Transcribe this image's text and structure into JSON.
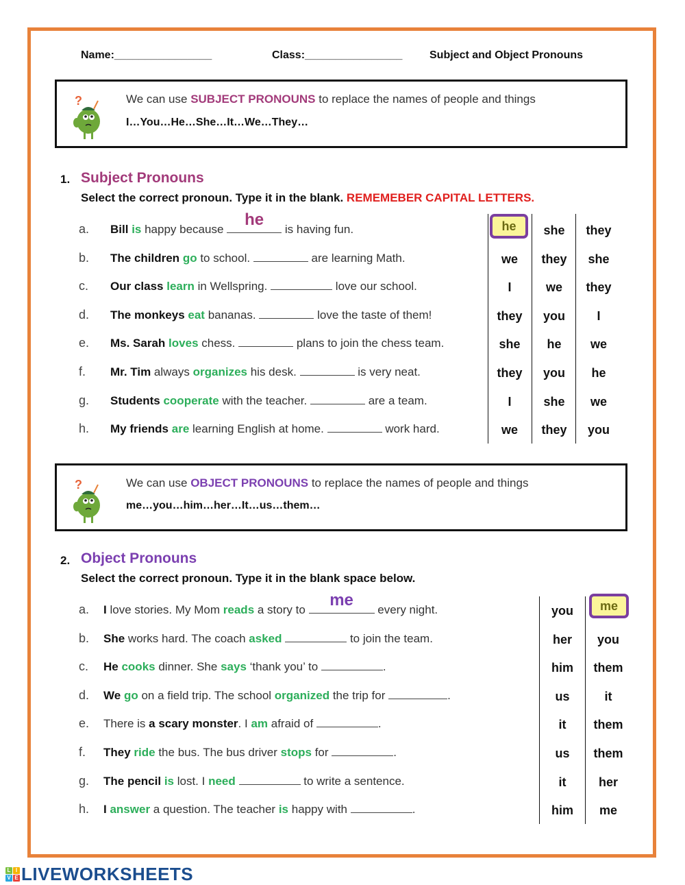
{
  "header": {
    "name_label": "Name:________________",
    "class_label": "Class:________________",
    "title": "Subject and Object Pronouns"
  },
  "colors": {
    "frame": "#e8823a",
    "subject_accent": "#a23a7a",
    "object_accent": "#7b3fb0",
    "verb_green": "#2cae5a",
    "warning_red": "#e0201e",
    "selected_fill": "#fbf59a",
    "selected_border": "#7b3fa0",
    "logo_blue": "#1b4d8e"
  },
  "info_subject": {
    "pre": "We can use ",
    "keyword": "SUBJECT PRONOUNS",
    "post": " to replace the names of people and things",
    "list": "I…You…He…She…It…We…They…",
    "icon": "confused-mascot-icon"
  },
  "info_object": {
    "pre": "We can use ",
    "keyword": "OBJECT PRONOUNS",
    "post": " to replace the names of people and things",
    "list": "me…you…him…her…It…us…them…",
    "icon": "confused-mascot-icon"
  },
  "section1": {
    "number": "1.",
    "title": "Subject Pronouns",
    "instruction": "Select the correct pronoun. Type it in the blank. ",
    "warning": "REMEMEBER CAPITAL LETTERS.",
    "questions": [
      {
        "letter": "a.",
        "subject": "Bill",
        "verb": "is",
        "mid": " happy because ",
        "after": " is having fun.",
        "answer": "he",
        "choices": [
          "he",
          "she",
          "they"
        ],
        "selected": 0
      },
      {
        "letter": "b.",
        "subject": "The children",
        "verb": "go",
        "mid": " to school. ",
        "after": " are learning Math.",
        "answer": "",
        "choices": [
          "we",
          "they",
          "she"
        ],
        "selected": -1
      },
      {
        "letter": "c.",
        "subject": "Our class",
        "verb": "learn",
        "mid": " in Wellspring. ",
        "after": " love our school.",
        "answer": "",
        "choices": [
          "I",
          "we",
          "they"
        ],
        "selected": -1
      },
      {
        "letter": "d.",
        "subject": "The monkeys",
        "verb": "eat",
        "mid": " bananas. ",
        "after": " love the taste of them!",
        "answer": "",
        "choices": [
          "they",
          "you",
          "I"
        ],
        "selected": -1
      },
      {
        "letter": "e.",
        "subject": "Ms. Sarah",
        "verb": "loves",
        "mid": " chess. ",
        "after": " plans to join the chess team.",
        "answer": "",
        "choices": [
          "she",
          "he",
          "we"
        ],
        "selected": -1
      },
      {
        "letter": "f.",
        "subject": "Mr. Tim",
        "pre_verb": " always ",
        "verb": "organizes",
        "mid": " his desk. ",
        "after": " is very neat.",
        "answer": "",
        "choices": [
          "they",
          "you",
          "he"
        ],
        "selected": -1
      },
      {
        "letter": "g.",
        "subject": "Students",
        "verb": "cooperate",
        "mid": " with the teacher. ",
        "after": " are a team.",
        "answer": "",
        "choices": [
          "I",
          "she",
          "we"
        ],
        "selected": -1
      },
      {
        "letter": "h.",
        "subject": "My friends",
        "verb": "are",
        "mid": " learning English at home. ",
        "after": " work hard.",
        "answer": "",
        "choices": [
          "we",
          "they",
          "you"
        ],
        "selected": -1
      }
    ]
  },
  "section2": {
    "number": "2.",
    "title": "Object Pronouns",
    "instruction": "Select the correct pronoun. Type it in the blank space below.",
    "questions": [
      {
        "letter": "a.",
        "parts": [
          {
            "t": "I",
            "s": "b"
          },
          {
            "t": " love stories. My Mom "
          },
          {
            "t": "reads",
            "s": "g"
          },
          {
            "t": " a story to "
          },
          {
            "blank": true
          },
          {
            "t": " every night."
          }
        ],
        "answer": "me",
        "choices": [
          "you",
          "me"
        ],
        "selected": 1
      },
      {
        "letter": "b.",
        "parts": [
          {
            "t": "She",
            "s": "b"
          },
          {
            "t": " works hard. The coach "
          },
          {
            "t": "asked",
            "s": "g"
          },
          {
            "t": " "
          },
          {
            "blank": true
          },
          {
            "t": " to join the team."
          }
        ],
        "answer": "",
        "choices": [
          "her",
          "you"
        ],
        "selected": -1
      },
      {
        "letter": "c.",
        "parts": [
          {
            "t": "He",
            "s": "b"
          },
          {
            "t": " "
          },
          {
            "t": "cooks",
            "s": "g"
          },
          {
            "t": " dinner. She "
          },
          {
            "t": "says",
            "s": "g"
          },
          {
            "t": " ‘thank you’ to "
          },
          {
            "blank": true
          },
          {
            "t": "."
          }
        ],
        "answer": "",
        "choices": [
          "him",
          "them"
        ],
        "selected": -1
      },
      {
        "letter": "d.",
        "parts": [
          {
            "t": "We",
            "s": "b"
          },
          {
            "t": " "
          },
          {
            "t": "go",
            "s": "g"
          },
          {
            "t": " on a field trip. The school "
          },
          {
            "t": "organized",
            "s": "g"
          },
          {
            "t": " the trip for "
          },
          {
            "blank": true
          },
          {
            "t": "."
          }
        ],
        "answer": "",
        "choices": [
          "us",
          "it"
        ],
        "selected": -1
      },
      {
        "letter": "e.",
        "parts": [
          {
            "t": "There is "
          },
          {
            "t": "a scary monster",
            "s": "b"
          },
          {
            "t": ". I "
          },
          {
            "t": "am",
            "s": "g"
          },
          {
            "t": " afraid of "
          },
          {
            "blank": true
          },
          {
            "t": "."
          }
        ],
        "answer": "",
        "choices": [
          "it",
          "them"
        ],
        "selected": -1
      },
      {
        "letter": "f.",
        "parts": [
          {
            "t": "They",
            "s": "b"
          },
          {
            "t": " "
          },
          {
            "t": "ride",
            "s": "g"
          },
          {
            "t": " the bus. The bus driver "
          },
          {
            "t": "stops",
            "s": "g"
          },
          {
            "t": " for "
          },
          {
            "blank": true
          },
          {
            "t": "."
          }
        ],
        "answer": "",
        "choices": [
          "us",
          "them"
        ],
        "selected": -1
      },
      {
        "letter": "g.",
        "parts": [
          {
            "t": "The pencil",
            "s": "b"
          },
          {
            "t": " "
          },
          {
            "t": "is",
            "s": "g"
          },
          {
            "t": " lost. I "
          },
          {
            "t": "need",
            "s": "g"
          },
          {
            "t": " "
          },
          {
            "blank": true
          },
          {
            "t": " to write a sentence."
          }
        ],
        "answer": "",
        "choices": [
          "it",
          "her"
        ],
        "selected": -1
      },
      {
        "letter": "h.",
        "parts": [
          {
            "t": "I",
            "s": "b"
          },
          {
            "t": " "
          },
          {
            "t": "answer",
            "s": "g"
          },
          {
            "t": " a question. The teacher "
          },
          {
            "t": "is",
            "s": "g"
          },
          {
            "t": " happy with "
          },
          {
            "blank": true
          },
          {
            "t": "."
          }
        ],
        "answer": "",
        "choices": [
          "him",
          "me"
        ],
        "selected": -1
      }
    ]
  },
  "footer": {
    "logo_tiles": [
      "L",
      "I",
      "V",
      "E"
    ],
    "logo_text": "LIVEWORKSHEETS"
  }
}
